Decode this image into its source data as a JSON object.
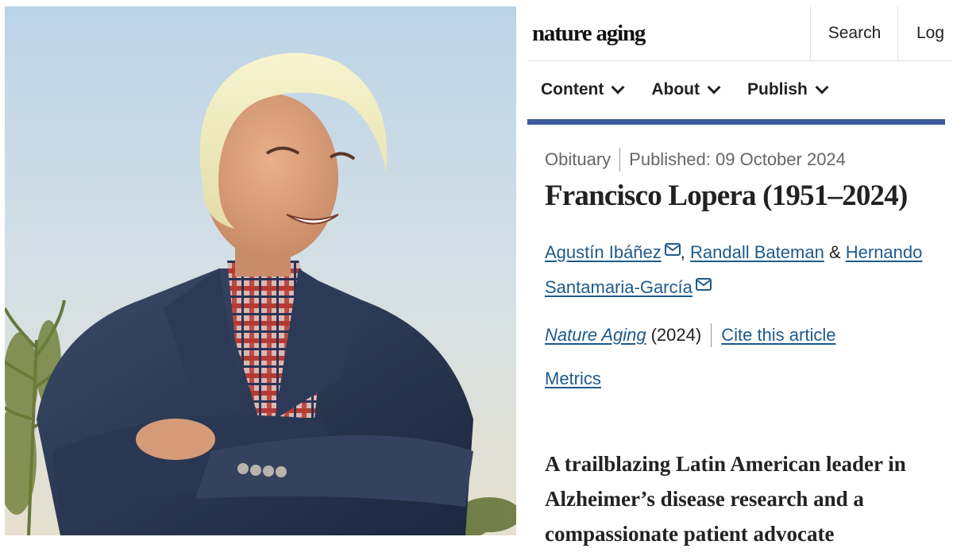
{
  "header": {
    "brand": "nature aging",
    "search_label": "Search",
    "login_label": "Log"
  },
  "nav": {
    "items": [
      {
        "label": "Content"
      },
      {
        "label": "About"
      },
      {
        "label": "Publish"
      }
    ]
  },
  "colors": {
    "accent_bar": "#3b5c9a",
    "link": "#1f5a8b"
  },
  "article": {
    "type": "Obituary",
    "published": "Published: 09 October 2024",
    "title": "Francisco Lopera (1951–2024)",
    "authors": [
      {
        "name": "Agustín Ibáñez",
        "has_email_icon": true
      },
      {
        "name": "Randall Bateman",
        "has_email_icon": false
      },
      {
        "name": "Hernando Santamaria-García",
        "has_email_icon": true
      }
    ],
    "author_separators": {
      "comma": ",",
      "ampersand": "&"
    },
    "journal": "Nature Aging",
    "year": "(2024)",
    "cite_label": "Cite this article",
    "metrics_label": "Metrics",
    "standfirst": "A trailblazing Latin American leader in Alzheimer’s disease research and a compassionate patient advocate"
  },
  "photo": {
    "description_icon": "portrait-photo"
  }
}
